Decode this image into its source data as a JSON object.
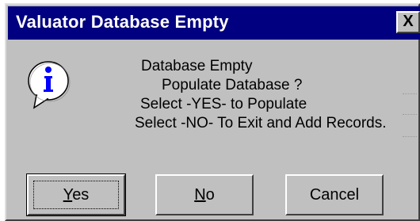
{
  "window": {
    "title": "Valuator Database Empty",
    "close_glyph": "X"
  },
  "icon": {
    "name": "information-icon",
    "glyph": "i",
    "color": "#0000ff"
  },
  "message": {
    "line1": "Database Empty",
    "line2": "Populate Database ?",
    "line3": "Select -YES- to Populate",
    "line4": "Select -NO- To Exit and Add Records."
  },
  "buttons": {
    "yes": {
      "mnemonic": "Y",
      "rest": "es"
    },
    "no": {
      "mnemonic": "N",
      "rest": "o"
    },
    "cancel": {
      "label": "Cancel"
    }
  },
  "colors": {
    "titlebar": "#000080",
    "dialog_bg": "#c0c0c0"
  }
}
